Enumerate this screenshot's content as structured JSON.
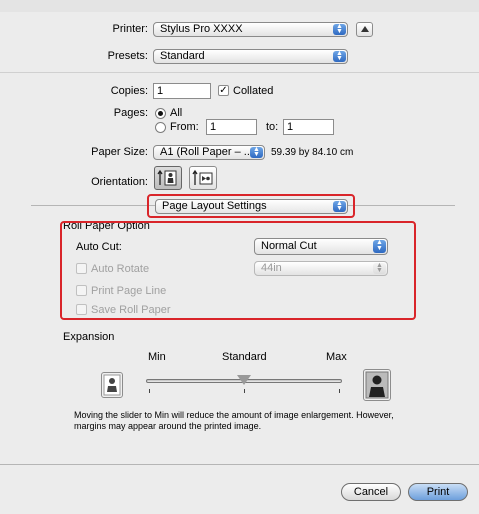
{
  "printer": {
    "label": "Printer:",
    "value": "Stylus Pro XXXX"
  },
  "presets": {
    "label": "Presets:",
    "value": "Standard"
  },
  "copies": {
    "label": "Copies:",
    "value": "1",
    "collated_label": "Collated",
    "collated": true
  },
  "pages": {
    "label": "Pages:",
    "all_label": "All",
    "from_label": "From:",
    "from_value": "1",
    "to_label": "to:",
    "to_value": "1",
    "selected": "All"
  },
  "paper_size": {
    "label": "Paper Size:",
    "value": "A1 (Roll Paper – ...",
    "dimensions": "59.39 by 84.10 cm"
  },
  "orientation": {
    "label": "Orientation:"
  },
  "panel_menu": {
    "value": "Page Layout Settings"
  },
  "roll_paper": {
    "heading": "Roll Paper Option",
    "auto_cut_label": "Auto Cut:",
    "auto_cut_value": "Normal Cut",
    "auto_rotate_label": "Auto Rotate",
    "auto_rotate_value": "44in",
    "print_page_line_label": "Print Page Line",
    "save_roll_paper_label": "Save Roll Paper"
  },
  "expansion": {
    "heading": "Expansion",
    "min_label": "Min",
    "standard_label": "Standard",
    "max_label": "Max",
    "slider_level": "Standard",
    "note": "Moving the slider to Min will reduce the amount of image enlargement. However, margins may appear around the printed image."
  },
  "buttons": {
    "cancel": "Cancel",
    "print": "Print"
  },
  "colors": {
    "highlight_box": "#d9252a",
    "popup_arrow": "#2e69c1"
  }
}
